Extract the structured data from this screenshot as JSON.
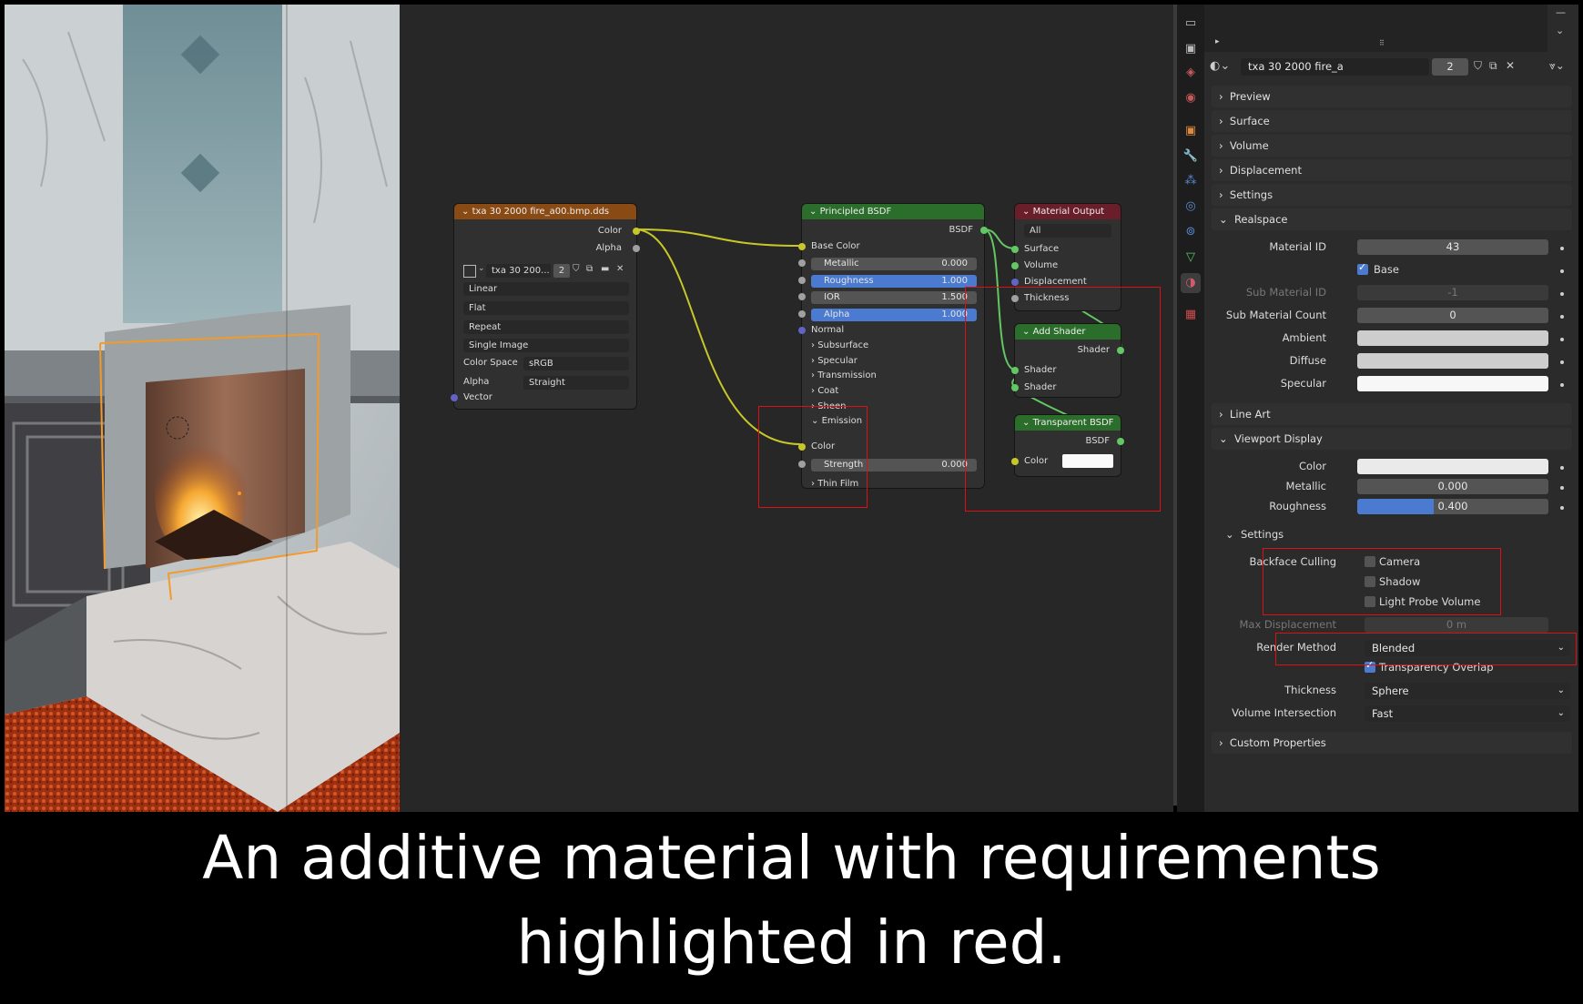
{
  "image_node": {
    "title": "txa 30 2000 fire_a00.bmp.dds",
    "outputs": [
      "Color",
      "Alpha"
    ],
    "image_name": "txa 30 200...",
    "users": "2",
    "interpolation": "Linear",
    "projection": "Flat",
    "extension": "Repeat",
    "source": "Single Image",
    "color_space_label": "Color Space",
    "color_space": "sRGB",
    "alpha_label": "Alpha",
    "alpha_mode": "Straight",
    "vector": "Vector",
    "colors": {
      "header": "#8a4a14",
      "color_socket": "#c7c729",
      "vector_socket": "#6363c7"
    }
  },
  "bsdf_node": {
    "title": "Principled BSDF",
    "output": "BSDF",
    "base_color": "Base Color",
    "fields": [
      {
        "label": "Metallic",
        "value": "0.000",
        "fill": 0.0
      },
      {
        "label": "Roughness",
        "value": "1.000",
        "fill": 1.0
      },
      {
        "label": "IOR",
        "value": "1.500",
        "fill": 0.0
      },
      {
        "label": "Alpha",
        "value": "1.000",
        "fill": 1.0
      }
    ],
    "normal": "Normal",
    "panels": [
      "Subsurface",
      "Specular",
      "Transmission",
      "Coat",
      "Sheen"
    ],
    "emission_panel": "Emission",
    "emission_color": "Color",
    "strength_label": "Strength",
    "strength_value": "0.000",
    "thin_film": "Thin Film",
    "colors": {
      "header": "#2b6d2b"
    }
  },
  "output_node": {
    "title": "Material Output",
    "target": "All",
    "inputs": [
      "Surface",
      "Volume",
      "Displacement",
      "Thickness"
    ],
    "colors": {
      "header": "#6a1e2a"
    }
  },
  "add_shader_node": {
    "title": "Add Shader",
    "output": "Shader",
    "inputs": [
      "Shader",
      "Shader"
    ]
  },
  "transparent_node": {
    "title": "Transparent BSDF",
    "output": "BSDF",
    "color_label": "Color"
  },
  "properties": {
    "material_name": "txa 30 2000 fire_a",
    "users": "2",
    "sections": {
      "preview": "Preview",
      "surface": "Surface",
      "volume": "Volume",
      "displacement": "Displacement",
      "settings": "Settings",
      "realspace": "Realspace",
      "line_art": "Line Art",
      "viewport_display": "Viewport Display",
      "custom_properties": "Custom Properties"
    },
    "realspace": {
      "material_id_label": "Material ID",
      "material_id": "43",
      "base_label": "Base",
      "sub_material_id_label": "Sub Material ID",
      "sub_material_id": "-1",
      "sub_material_count_label": "Sub Material Count",
      "sub_material_count": "0",
      "ambient_label": "Ambient",
      "diffuse_label": "Diffuse",
      "specular_label": "Specular"
    },
    "viewport_display": {
      "color_label": "Color",
      "metallic_label": "Metallic",
      "metallic": "0.000",
      "roughness_label": "Roughness",
      "roughness": "0.400",
      "roughness_fill": 0.4,
      "settings_label": "Settings",
      "backface_culling_label": "Backface Culling",
      "camera_label": "Camera",
      "shadow_label": "Shadow",
      "light_probe_label": "Light Probe Volume",
      "max_displacement_label": "Max Displacement",
      "max_displacement": "0 m",
      "render_method_label": "Render Method",
      "render_method": "Blended",
      "transparency_overlap_label": "Transparency Overlap",
      "thickness_label": "Thickness",
      "thickness": "Sphere",
      "volume_intersection_label": "Volume Intersection",
      "volume_intersection": "Fast"
    }
  },
  "caption": {
    "line1": "An additive material with requirements",
    "line2": "highlighted in red."
  },
  "colors": {
    "highlight": "#dd1111",
    "accent_blue": "#4a7bd0",
    "selection_orange": "#f39a2a",
    "link_yellow": "#c7c729",
    "link_green": "#63c763"
  }
}
